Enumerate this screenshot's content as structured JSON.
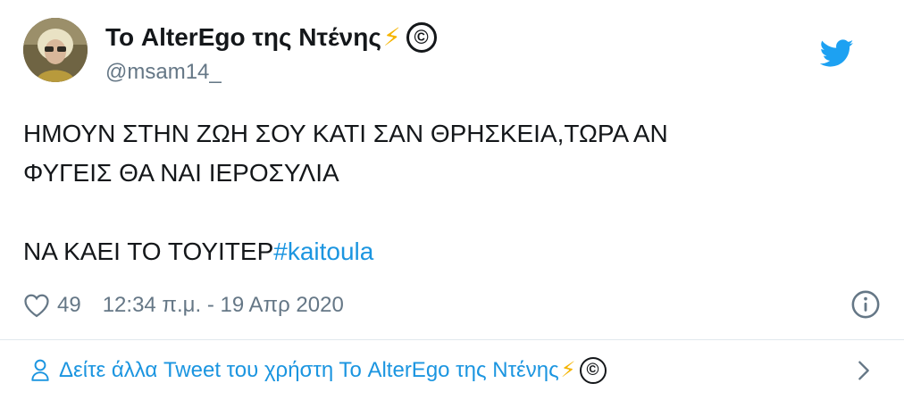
{
  "author": {
    "display_name": "Το AlterEgo της Ντένης",
    "display_emoji_bolt": "⚡",
    "display_emoji_copyright": "©",
    "handle": "@msam14_"
  },
  "tweet": {
    "line1": "ΗΜΟΥΝ ΣΤΗΝ ΖΩΗ ΣΟΥ ΚΑΤΙ ΣΑΝ ΘΡΗΣΚΕΙΑ,ΤΩΡΑ ΑΝ",
    "line2": "ΦΥΓΕΙΣ ΘΑ ΝΑΙ ΙΕΡΟΣΥΛΙΑ",
    "line3_text": "ΝΑ ΚΑΕΙ ΤΟ ΤΟΥΙΤΕΡ",
    "hashtag": "#kaitoula"
  },
  "meta": {
    "likes": "49",
    "timestamp": "12:34 π.μ. - 19 Απρ 2020"
  },
  "footer": {
    "label": "Δείτε άλλα Tweet του χρήστη Το AlterEgo της Ντένης",
    "emoji_bolt": "⚡",
    "emoji_copyright": "©"
  },
  "colors": {
    "link": "#1b95e0",
    "muted": "#657786",
    "text": "#14171a",
    "divider": "#e1e8ed"
  },
  "icons": [
    "twitter-bird-icon",
    "heart-icon",
    "info-icon",
    "person-icon",
    "chevron-right-icon"
  ]
}
